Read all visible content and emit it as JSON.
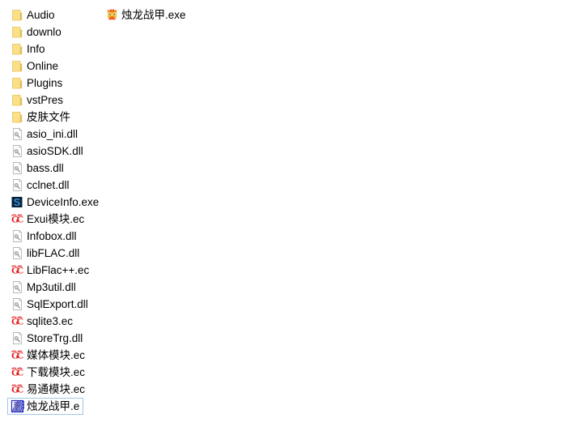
{
  "window": {
    "background_color": "#ffffff",
    "selection_border_color": "#9cc7e8",
    "text_color": "#000000"
  },
  "columns": [
    {
      "name": "column-1",
      "items": [
        {
          "label": "Audio",
          "icon": "folder-icon"
        },
        {
          "label": "downlo",
          "icon": "folder-icon"
        },
        {
          "label": "Info",
          "icon": "folder-icon"
        },
        {
          "label": "Online",
          "icon": "folder-icon"
        },
        {
          "label": "Plugins",
          "icon": "folder-icon"
        },
        {
          "label": "vstPres",
          "icon": "folder-icon"
        },
        {
          "label": "皮肤文件",
          "icon": "folder-icon"
        },
        {
          "label": "asio_ini.dll",
          "icon": "dll-file-icon"
        },
        {
          "label": "asioSDK.dll",
          "icon": "dll-file-icon"
        },
        {
          "label": "bass.dll",
          "icon": "dll-file-icon"
        },
        {
          "label": "cclnet.dll",
          "icon": "dll-file-icon"
        },
        {
          "label": "DeviceInfo.exe",
          "icon": "device-info-exe-icon"
        },
        {
          "label": "Exui模块.ec",
          "icon": "ec-module-icon"
        },
        {
          "label": "Infobox.dll",
          "icon": "dll-file-icon"
        },
        {
          "label": "libFLAC.dll",
          "icon": "dll-file-icon"
        },
        {
          "label": "LibFlac++.ec",
          "icon": "ec-module-icon"
        },
        {
          "label": "Mp3util.dll",
          "icon": "dll-file-icon"
        },
        {
          "label": "SqlExport.dll",
          "icon": "dll-file-icon"
        },
        {
          "label": "sqlite3.ec",
          "icon": "ec-module-icon"
        },
        {
          "label": "StoreTrg.dll",
          "icon": "dll-file-icon"
        },
        {
          "label": "媒体模块.ec",
          "icon": "ec-module-icon"
        },
        {
          "label": "下载模块.ec",
          "icon": "ec-module-icon"
        },
        {
          "label": "易通模块.ec",
          "icon": "ec-module-icon"
        },
        {
          "label": "烛龙战甲.e",
          "icon": "e-source-icon",
          "selected": true
        }
      ]
    },
    {
      "name": "column-2",
      "items": [
        {
          "label": "烛龙战甲.exe",
          "icon": "lion-mascot-exe-icon"
        }
      ]
    }
  ]
}
